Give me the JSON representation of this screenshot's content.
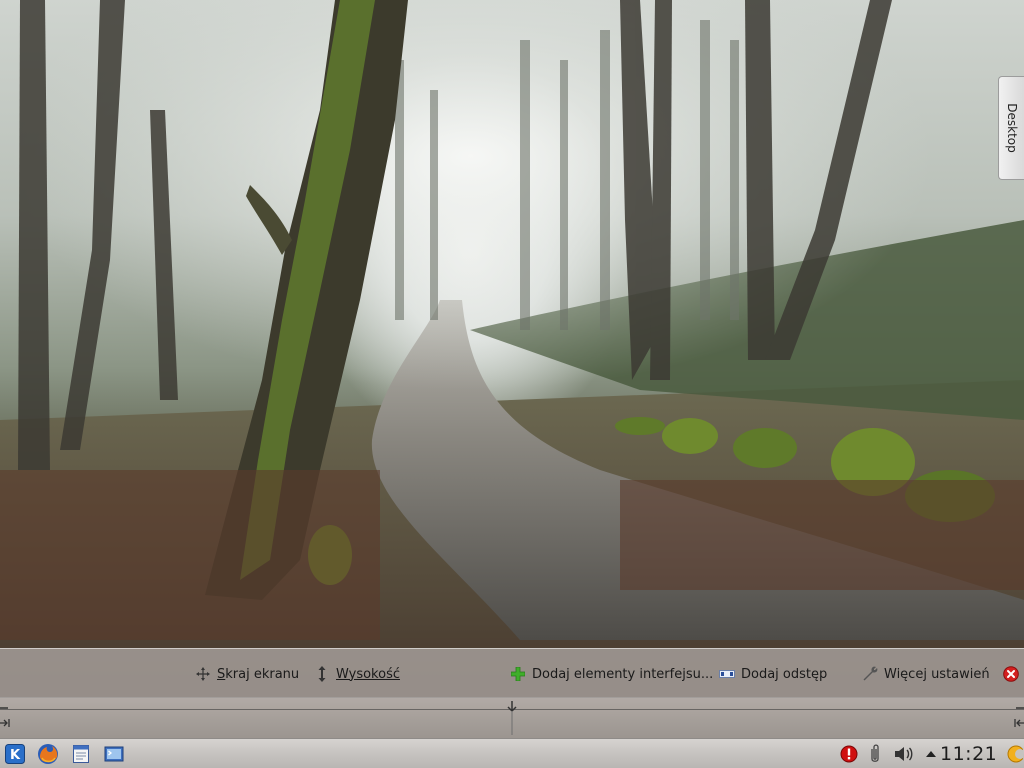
{
  "desktop": {
    "toolbox_label": "Desktop"
  },
  "panel_controller": {
    "screen_edge_label": "Skraj ekranu",
    "screen_edge_mnemonic": "S",
    "height_label": "Wysokość",
    "add_widgets_label": "Dodaj elementy interfejsu...",
    "add_spacer_label": "Dodaj odstęp",
    "more_settings_label": "Więcej ustawień",
    "icons": {
      "screen_edge": "move-icon",
      "height": "resize-vertical-icon",
      "add_widgets": "plus-icon",
      "add_spacer": "spacer-icon",
      "more_settings": "wrench-icon",
      "close": "close-icon"
    }
  },
  "taskbar": {
    "launchers": [
      "kde-menu-icon",
      "firefox-icon",
      "file-manager-icon",
      "terminal-icon"
    ],
    "tray": [
      "update-alert-icon",
      "klipper-clipboard-icon",
      "volume-icon",
      "expand-tray-icon"
    ],
    "clock": "11:21",
    "extra": "cashew-icon"
  },
  "colors": {
    "panel_bg": "#aaa4a0",
    "taskbar_bg": "#c6c3c0",
    "kde_blue": "#2a6fc9",
    "alert_red": "#d01010"
  }
}
